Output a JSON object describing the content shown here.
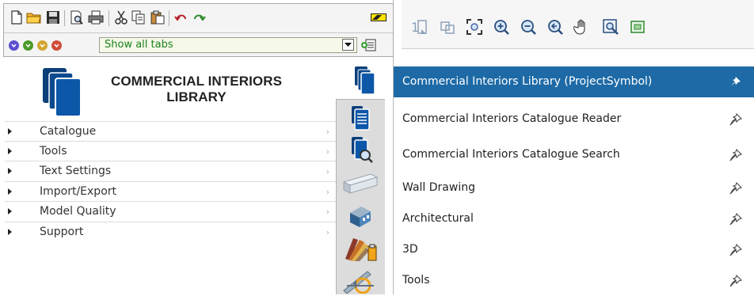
{
  "toolbar": {
    "buttons": [
      {
        "name": "new-document-icon",
        "label": "New"
      },
      {
        "name": "open-folder-icon",
        "label": "Open"
      },
      {
        "name": "save-icon",
        "label": "Save"
      },
      {
        "name": "print-preview-icon",
        "label": "Print Preview"
      },
      {
        "name": "print-icon",
        "label": "Print"
      },
      {
        "name": "cut-icon",
        "label": "Cut"
      },
      {
        "name": "copy-icon",
        "label": "Copy"
      },
      {
        "name": "paste-icon",
        "label": "Paste"
      },
      {
        "name": "undo-icon",
        "label": "Undo"
      },
      {
        "name": "redo-icon",
        "label": "Redo"
      },
      {
        "name": "battery-icon",
        "label": "Status"
      }
    ]
  },
  "tabs": {
    "selected_value": "Show all tabs",
    "nav_colors": [
      "#5a4fd0",
      "#4b9a2a",
      "#d1a531",
      "#d04b3a"
    ]
  },
  "library": {
    "title": "COMMERCIAL INTERIORS LIBRARY",
    "brand_color": "#0c57a8"
  },
  "menu": {
    "items": [
      {
        "label": "Catalogue"
      },
      {
        "label": "Tools"
      },
      {
        "label": "Text Settings"
      },
      {
        "label": "Import/Export"
      },
      {
        "label": "Model Quality"
      },
      {
        "label": "Support"
      }
    ]
  },
  "tab_strip": {
    "icons": [
      "library-stack-icon",
      "catalogue-reader-icon",
      "catalogue-search-icon",
      "wall-drawing-icon",
      "architectural-building-icon",
      "3d-swatch-icon",
      "tools-ruler-icon"
    ]
  },
  "right_toolbar": {
    "buttons": [
      {
        "name": "zoom-1-icon"
      },
      {
        "name": "zoom-fit-selection-icon"
      },
      {
        "name": "zoom-extents-icon"
      },
      {
        "name": "zoom-in-icon"
      },
      {
        "name": "zoom-out-icon"
      },
      {
        "name": "zoom-previous-icon"
      },
      {
        "name": "pan-hand-icon"
      },
      {
        "name": "zoom-window-icon"
      },
      {
        "name": "refresh-view-icon"
      }
    ]
  },
  "libraries": [
    {
      "label": "Commercial Interiors Library (ProjectSymbol)",
      "selected": true
    },
    {
      "label": "Commercial Interiors Catalogue Reader",
      "selected": false
    },
    {
      "label": "Commercial Interiors Catalogue Search",
      "selected": false
    },
    {
      "label": "Wall Drawing",
      "selected": false
    },
    {
      "label": "Architectural",
      "selected": false
    },
    {
      "label": "3D",
      "selected": false
    },
    {
      "label": "Tools",
      "selected": false
    }
  ],
  "colors": {
    "selected_row": "#1d6aa6",
    "select_field_text": "#188018",
    "select_field_bg": "#f6f9e9"
  }
}
